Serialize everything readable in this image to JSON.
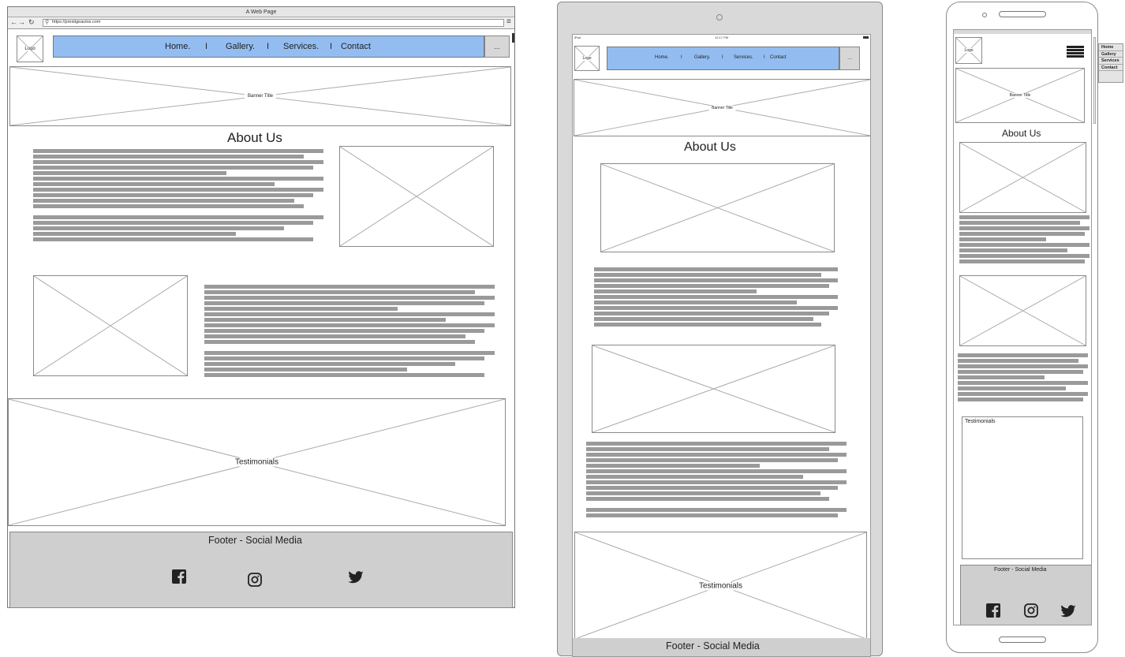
{
  "desktop": {
    "window_title": "A Web Page",
    "url": "https://prestigeautos.com",
    "logo": "Logo",
    "nav": {
      "home": "Home.",
      "gallery": "Gallery.",
      "services": "Services.",
      "contact": "Contact",
      "sep": "I",
      "more": "..."
    },
    "banner": "Banner Title",
    "about_heading": "About Us",
    "testimonials": "Testimonials",
    "footer_title": "Footer - Social Media"
  },
  "tablet": {
    "status_device": "iPad",
    "status_time": "12:17 PM",
    "logo": "Logo",
    "nav": {
      "home": "Home.",
      "gallery": "Gallery.",
      "services": "Services.",
      "contact": "Contact",
      "sep": "I",
      "more": "..."
    },
    "banner": "Banner Title",
    "about_heading": "About Us",
    "testimonials": "Testimonials",
    "footer_title": "Footer  - Social Media"
  },
  "phone": {
    "logo": "Logo",
    "banner": "Banner Title",
    "about_heading": "About Us",
    "testimonials": "Testimonials",
    "footer_title": "Footer - Social Media"
  },
  "side_menu": {
    "items": [
      "Home",
      "Gallery",
      "Services",
      "Contact"
    ]
  },
  "icons": {
    "facebook": "facebook-icon",
    "instagram": "instagram-icon",
    "twitter": "twitter-icon"
  },
  "colors": {
    "nav_blue": "#93bdf1",
    "footer_gray": "#cfcfcf",
    "text_bar_gray": "#9a9a9a"
  }
}
